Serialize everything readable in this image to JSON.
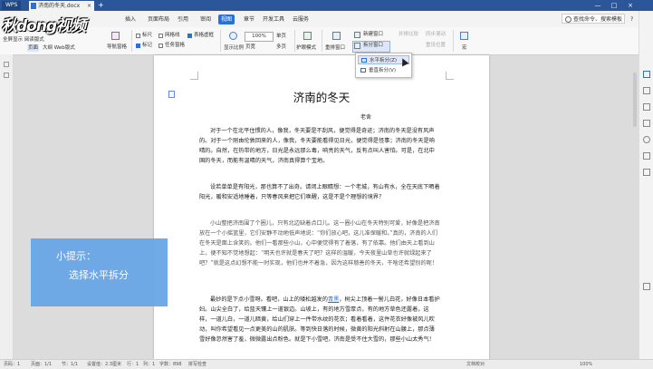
{
  "titlebar": {
    "app_label": "WPS",
    "doc_tab": "济南的冬天.docx",
    "close_glyph": "×",
    "new_tab_glyph": "+",
    "minimize_glyph": "—",
    "maximize_glyph": "□",
    "close_window_glyph": "×"
  },
  "logo_text": "秋dong视频",
  "menu": {
    "items": [
      "插入",
      "页面布局",
      "引用",
      "审阅",
      "视图",
      "章节",
      "开发工具",
      "云服务"
    ],
    "active_index": 4,
    "search_placeholder": "查找命令、搜索模板",
    "extra": "?"
  },
  "ribbon": {
    "left_row1": "全屏显示  阅读版式",
    "left_row2_page": "页面",
    "left_row2_rest": "大纲  Web版式",
    "nav_label": "导航窗格",
    "check_outline": "标尺",
    "check_grid": "网格线",
    "check_markup": "标记",
    "check_taskpane": "任务窗格",
    "check_table": "表格虚框",
    "zoom_label": "显示比例",
    "zoom_value": "100%",
    "one_page": "单页",
    "page_width": "页宽",
    "multi_page": "多页",
    "eye_label": "护眼模式",
    "rearrange": "重排窗口",
    "new_window": "新建窗口",
    "split_window": "拆分窗口",
    "side_by_side": "并排比较",
    "sync_scroll": "同步滚动",
    "reset_pos": "重设位置",
    "macro": "宏"
  },
  "dropdown": {
    "items": [
      "水平拆分(Z)",
      "垂直拆分(V)"
    ],
    "highlighted_index": 0
  },
  "document": {
    "title": "济南的冬天",
    "author": "老舍",
    "paragraphs": [
      "对于一个在北平住惯的人，像我，冬天要是不刮风，便觉得是奇迹；济南的冬天是没有风声的。对于一个刚由伦敦回来的人，像我，冬天要能看得见日光，便觉得是怪事；济南的冬天是响晴的。自然，在热带的地方，日光是永远那么毒，响亮的天气，反有点叫人害怕。可是，在北中国的冬天，而能有温晴的天气，济南真得算个宝地。",
      "设若单单是有阳光，那也算不了出奇。请闭上眼睛想：一个老城，有山有水，全在天底下晒着阳光，暖和安适地睡着，只等春风来把它们唤醒，这是不是个理想的境界？",
      "小山整把济南围了个圈儿，只有北边缺着点口儿。这一圈小山在冬天特别可爱，好像是把济南放在一个小摇篮里，它们安静不动地低声地说：“你们放心吧，这儿准保暖和。”真的，济南的人们在冬天是面上含笑的。他们一看那些小山，心中便觉得有了着落，有了依靠。他们由天上看到山上，便不知不觉地想起：“明天也许就是春天了吧？这样的温暖，今天夜里山草也许就绿起来了吧？”就是这点幻想不能一时实现，他们也并不着急，因为这样慈善的冬天，干啥还希望别的呢！",
      "最妙的是下点小雪呀。看吧，山上的矮松越发的青黑，树尖上顶着一髻儿白花，好像日本看护妇。山尖全白了，给蓝天镶上一道银边。山坡上，有的地方雪厚点，有的地方草色还露着，这样，一道儿白，一道儿暗黄，给山们穿上一件带水纹的花衣；看着看着，这件花衣好像被风儿吹动，叫你希望看见一点更美的山的肌肤。等到快日落的时候，微黄的阳光斜射在山腰上，那点薄雪好像忽然害了羞，微微露出点粉色。就是下小雪吧，济南是受不住大雪的，那些小山太秀气！"
    ],
    "para4_prefix": "最妙的是下点小雪呀。看吧，山上的矮松越发的",
    "para4_link": "青黑",
    "para4_suffix": "，树尖上顶着一髻儿白花，好像日本看护妇。山尖全白了，给蓝天镶上一道银边。山坡上，有的地方雪厚点，有的地方草色还露着，这样，一道儿白，一道儿暗黄，给山们穿上一件带水纹的花衣；看着看着，这件花衣好像被风儿吹动，叫你希望看见一点更美的山的肌肤。等到快日落的时候，微黄的阳光斜射在山腰上，那点薄雪好像忽然害了羞，微微露出点粉色。就是下小雪吧，济南是受不住大雪的，那些小山太秀气！"
  },
  "tip": {
    "title": "小提示：",
    "text": "选择水平拆分"
  },
  "statusbar": {
    "page": "页码：1",
    "pages": "页面：1/1",
    "section": "节：1/1",
    "position": "设置值：2.3厘米",
    "row": "行：1",
    "col": "列：1",
    "words": "字数：898",
    "spell": "拼写检查",
    "doc_check": "文档校对",
    "zoom": "100%"
  },
  "colors": {
    "titlebar": "#2b579a",
    "accent": "#2b6fd8",
    "tip_bg": "#6aa7e6"
  }
}
